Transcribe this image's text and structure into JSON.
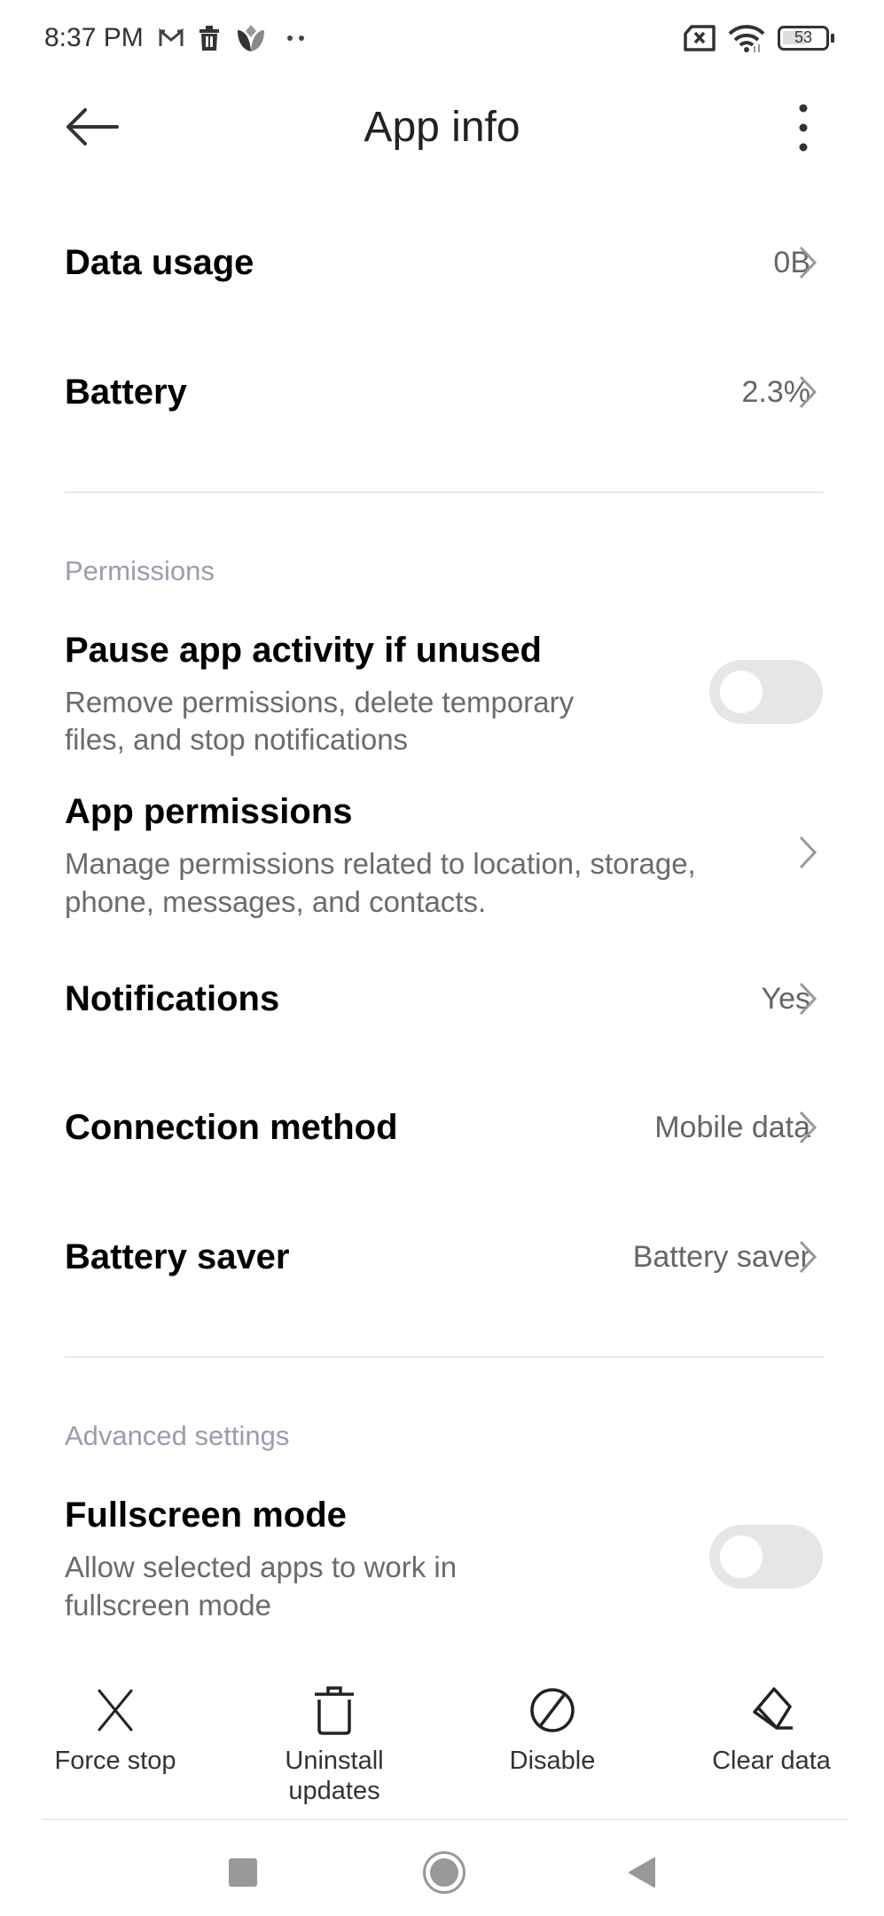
{
  "status_bar": {
    "time": "8:37 PM",
    "notification_icons": [
      "gmail-icon",
      "trash-icon",
      "tulip-icon",
      "more-dots-icon"
    ],
    "system_icons": [
      "no-sim-icon",
      "wifi-icon",
      "battery-icon"
    ],
    "battery_level": "53"
  },
  "header": {
    "title": "App info",
    "back_icon": "arrow-left-icon",
    "menu_icon": "more-vertical-icon"
  },
  "rows": {
    "data_usage": {
      "title": "Data usage",
      "value": "0B"
    },
    "battery": {
      "title": "Battery",
      "value": "2.3%"
    }
  },
  "permissions": {
    "header": "Permissions",
    "pause_app": {
      "title": "Pause app activity if unused",
      "desc_line1": "Remove permissions, delete temporary",
      "desc_line2": "files, and stop notifications",
      "enabled": false
    },
    "app_permissions": {
      "title": "App permissions",
      "desc_line1": "Manage permissions related to location, storage,",
      "desc_line2": "phone, messages, and contacts."
    },
    "notifications": {
      "title": "Notifications",
      "value": "Yes"
    },
    "connection_method": {
      "title": "Connection method",
      "value": "Mobile data"
    },
    "battery_saver": {
      "title": "Battery saver",
      "value": "Battery saver"
    }
  },
  "advanced": {
    "header": "Advanced settings",
    "fullscreen": {
      "title": "Fullscreen mode",
      "desc_line1": "Allow selected apps to work in",
      "desc_line2": "fullscreen mode",
      "enabled": false
    }
  },
  "actions": [
    {
      "label": "Force stop",
      "icon": "close-x-icon"
    },
    {
      "label_line1": "Uninstall",
      "label_line2": "updates",
      "icon": "trash-icon"
    },
    {
      "label": "Disable",
      "icon": "block-icon"
    },
    {
      "label": "Clear data",
      "icon": "eraser-icon"
    }
  ],
  "nav_bar": {
    "recents": "recents-square-icon",
    "home": "home-circle-icon",
    "back": "back-triangle-icon"
  },
  "colors": {
    "section_header": "#9a9cb0",
    "value_text": "#666666",
    "toggle_off": "#e6e6e6"
  }
}
